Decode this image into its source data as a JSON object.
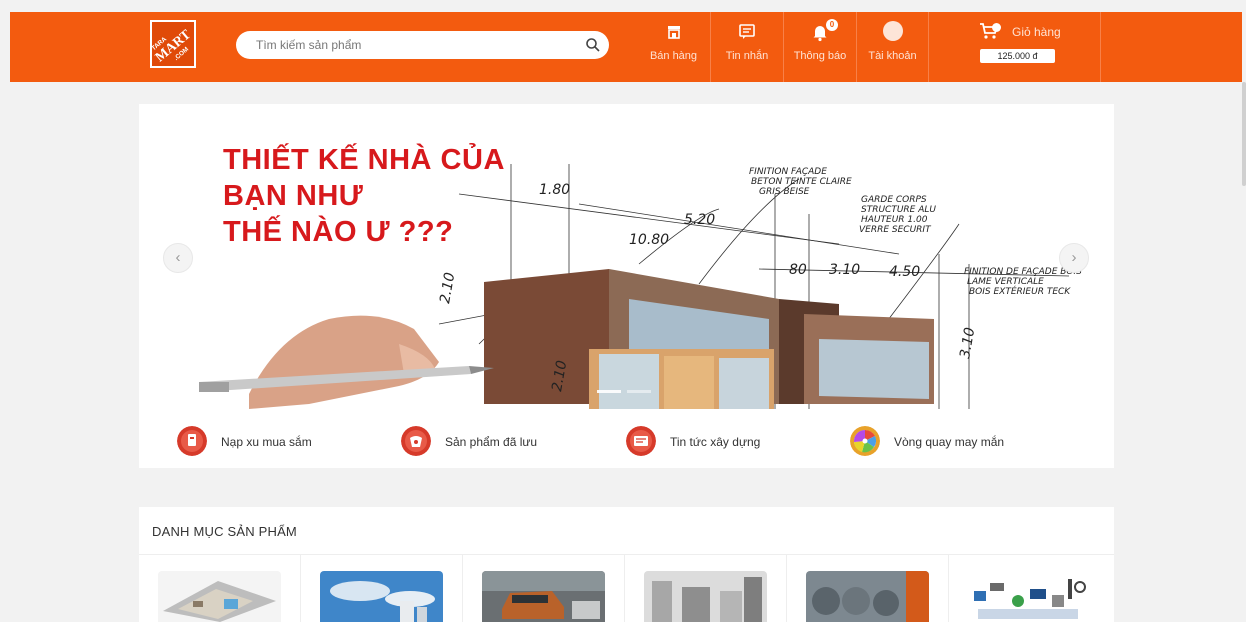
{
  "header": {
    "logo_text": "TARA MART .COM",
    "search": {
      "placeholder": "Tìm kiếm sản phẩm",
      "value": ""
    },
    "nav": [
      {
        "label": "Bán hàng",
        "icon": "store-icon"
      },
      {
        "label": "Tin nhắn",
        "icon": "message-icon"
      },
      {
        "label": "Thông báo",
        "icon": "bell-icon",
        "badge": "0"
      },
      {
        "label": "Tài khoản",
        "icon": "user-avatar-icon"
      }
    ],
    "cart": {
      "label": "Giỏ hàng",
      "price": "125.000 đ",
      "icon": "cart-icon"
    }
  },
  "banner": {
    "title_line1": "THIẾT KẾ NHÀ CỦA",
    "title_line2": "BẠN NHƯ",
    "title_line3": "THẾ NÀO Ư ???",
    "prev": "‹",
    "next": "›"
  },
  "quick_links": [
    {
      "label": "Nạp xu mua sắm",
      "icon": "coin-topup-icon",
      "color": "#d63a2a"
    },
    {
      "label": "Sản phẩm đã lưu",
      "icon": "saved-products-icon",
      "color": "#d63a2a"
    },
    {
      "label": "Tin tức xây dựng",
      "icon": "news-icon",
      "color": "#d63a2a"
    },
    {
      "label": "Vòng quay may mắn",
      "icon": "lucky-wheel-icon",
      "color": "#e8a22a"
    }
  ],
  "categories": {
    "title": "DANH MỤC SẢN PHẨM"
  },
  "colors": {
    "brand": "#f35b0f",
    "banner_title": "#d7191c"
  }
}
